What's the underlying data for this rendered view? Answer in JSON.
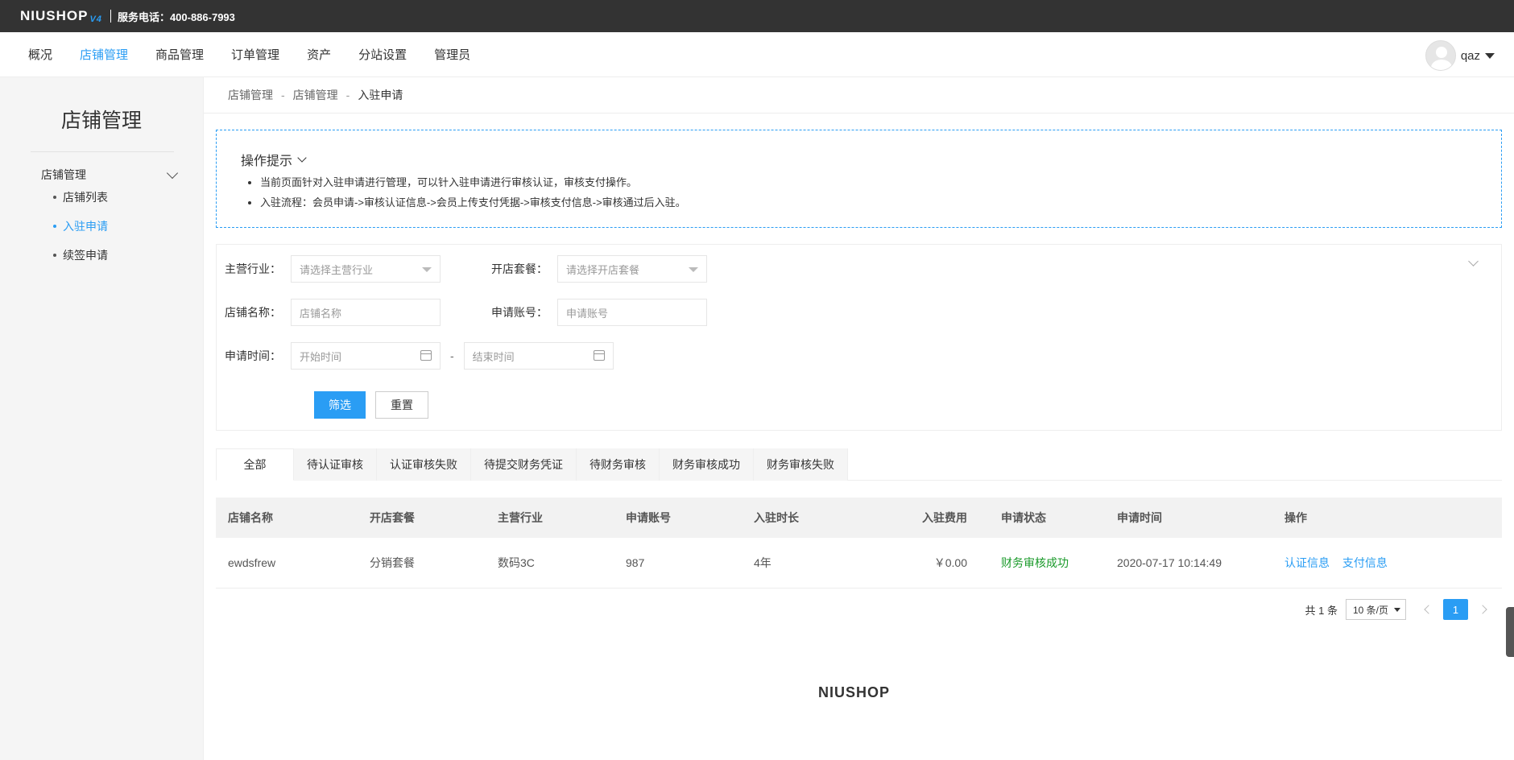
{
  "topbar": {
    "logo_text": "NIUSHOP",
    "logo_version": "V4",
    "service_phone": "服务电话：400-886-7993"
  },
  "mainnav": {
    "items": [
      {
        "label": "概况"
      },
      {
        "label": "店铺管理",
        "active": true
      },
      {
        "label": "商品管理"
      },
      {
        "label": "订单管理"
      },
      {
        "label": "资产"
      },
      {
        "label": "分站设置"
      },
      {
        "label": "管理员"
      }
    ],
    "username": "qaz"
  },
  "sidebar": {
    "title": "店铺管理",
    "group_label": "店铺管理",
    "items": [
      {
        "label": "店铺列表"
      },
      {
        "label": "入驻申请",
        "active": true
      },
      {
        "label": "续签申请"
      }
    ]
  },
  "breadcrumb": {
    "items": [
      "店铺管理",
      "店铺管理",
      "入驻申请"
    ],
    "separator": "-"
  },
  "tips": {
    "title": "操作提示",
    "lines": [
      "当前页面针对入驻申请进行管理，可以针入驻申请进行审核认证，审核支付操作。",
      "入驻流程：会员申请->审核认证信息->会员上传支付凭据->审核支付信息->审核通过后入驻。"
    ]
  },
  "filter": {
    "industry_label": "主营行业：",
    "industry_placeholder": "请选择主营行业",
    "package_label": "开店套餐：",
    "package_placeholder": "请选择开店套餐",
    "shop_name_label": "店铺名称：",
    "shop_name_placeholder": "店铺名称",
    "account_label": "申请账号：",
    "account_placeholder": "申请账号",
    "time_label": "申请时间：",
    "start_placeholder": "开始时间",
    "end_placeholder": "结束时间",
    "range_separator": "-",
    "search_button": "筛选",
    "reset_button": "重置"
  },
  "tabs": [
    {
      "label": "全部",
      "active": true
    },
    {
      "label": "待认证审核"
    },
    {
      "label": "认证审核失败"
    },
    {
      "label": "待提交财务凭证"
    },
    {
      "label": "待财务审核"
    },
    {
      "label": "财务审核成功"
    },
    {
      "label": "财务审核失败"
    }
  ],
  "table": {
    "columns": [
      "店铺名称",
      "开店套餐",
      "主营行业",
      "申请账号",
      "入驻时长",
      "入驻费用",
      "申请状态",
      "申请时间",
      "操作"
    ],
    "rows": [
      {
        "shop_name": "ewdsfrew",
        "package": "分销套餐",
        "industry": "数码3C",
        "account": "987",
        "duration": "4年",
        "fee": "￥0.00",
        "status": "财务审核成功",
        "time": "2020-07-17 10:14:49",
        "actions": [
          "认证信息",
          "支付信息"
        ]
      }
    ]
  },
  "pager": {
    "total": "共 1 条",
    "page_size": "10 条/页",
    "current_page": "1"
  },
  "footer": {
    "logo_text": "NIUSHOP"
  },
  "colors": {
    "accent": "#2a9df4",
    "topbar": "#333333",
    "success": "#1a9a2a"
  }
}
